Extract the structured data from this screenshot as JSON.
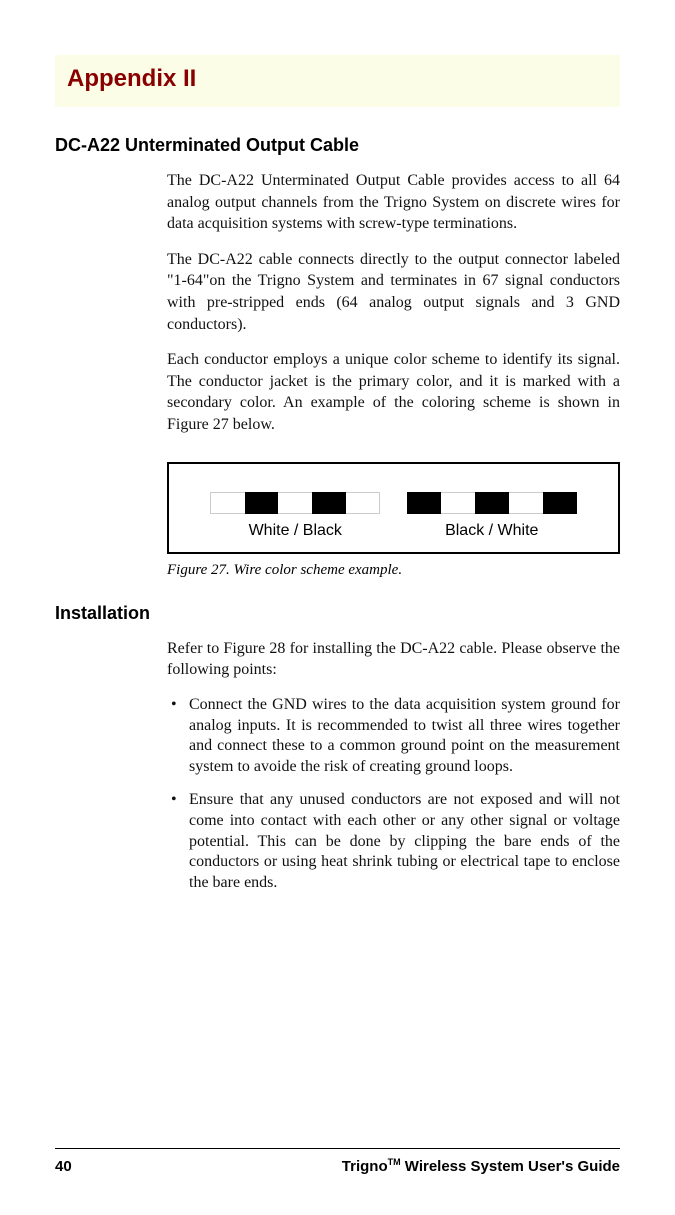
{
  "appendix": {
    "title": "Appendix II"
  },
  "section1": {
    "heading": "DC-A22 Unterminated Output Cable",
    "p1": "The DC-A22 Unterminated Output Cable provides access to all 64 analog output channels from the Trigno System on discrete wires for data acquisition systems with screw-type terminations.",
    "p2": "The DC-A22 cable connects directly to the output connector labeled \"1-64\"on the Trigno System and terminates in 67 signal conductors with pre-stripped ends (64 analog output signals and 3 GND conductors).",
    "p3": "Each conductor employs a unique color scheme to identify its signal. The conductor jacket is the primary color, and it is marked with a secondary color. An example of the coloring scheme is shown in Figure 27 below."
  },
  "figure": {
    "label_left": "White / Black",
    "label_right": "Black / White",
    "caption": "Figure 27. Wire color scheme example."
  },
  "section2": {
    "heading": "Installation",
    "intro": "Refer to Figure 28 for installing the DC-A22 cable. Please observe the following points:",
    "bullets": {
      "b1": "Connect the GND wires to the data acquisition system ground for analog inputs.  It is recommended to twist all three wires together and connect these to a common ground point on the measurement system to avoide the risk of creating ground loops.",
      "b2": "Ensure that any unused conductors are not exposed and will not come into contact with each other or any other signal or voltage potential.  This can be done by clipping the bare ends of the conductors or using heat shrink tubing or electrical tape to enclose the bare ends."
    }
  },
  "footer": {
    "page": "40",
    "brand": "Trigno",
    "tm": "TM",
    "rest": " Wireless System User's Guide"
  }
}
